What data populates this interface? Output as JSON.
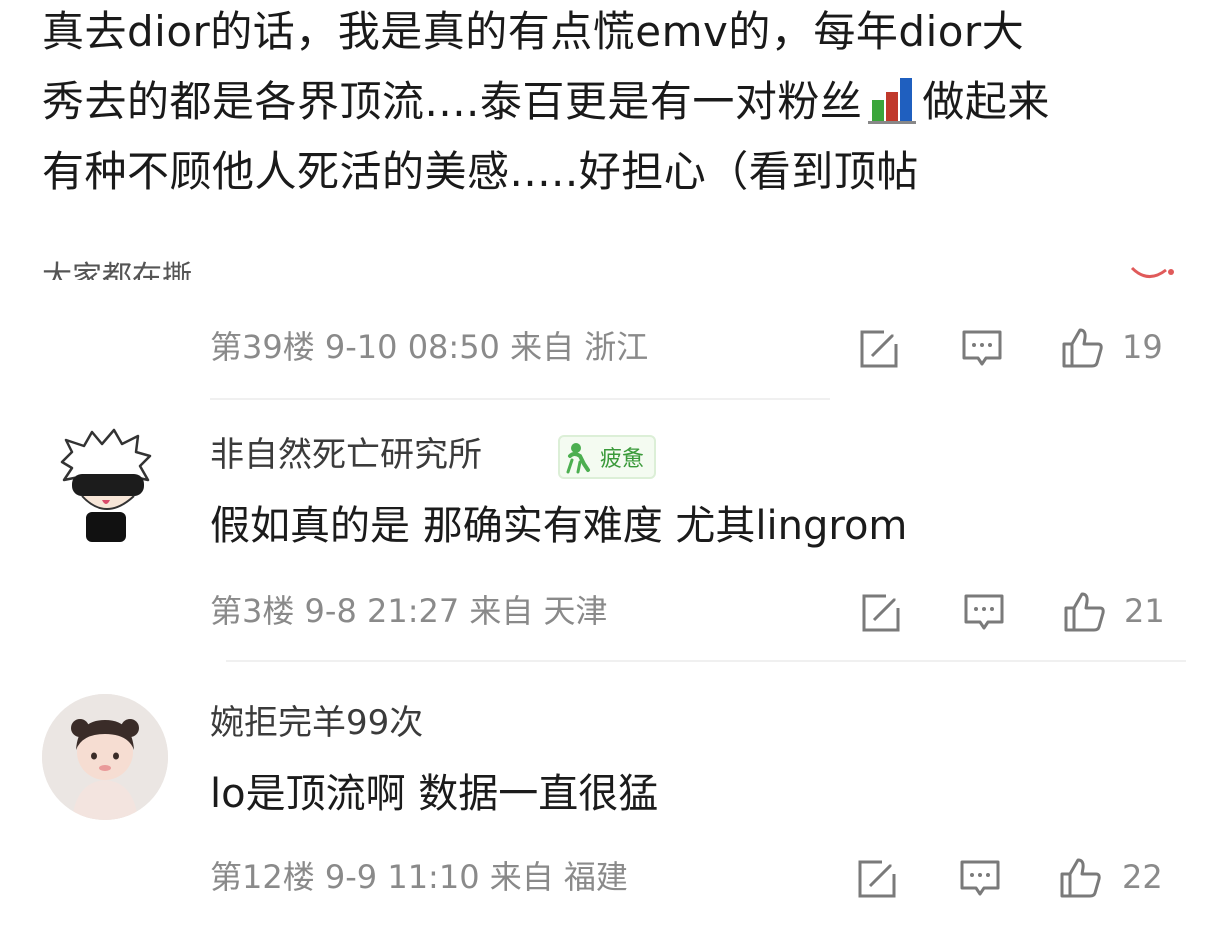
{
  "top_comment": {
    "line1": "真去dior的话，我是真的有点慌emv的，每年dior大",
    "line2_pre": "秀去的都是各界顶流....泰百更是有一对粉丝",
    "line2_post": "做起来",
    "line3": "有种不顾他人死活的美感.....好担心（看到顶帖",
    "emoji_icon": "bar-chart-emoji"
  },
  "reply_peek": {
    "text": "大家都在撕"
  },
  "post_39": {
    "meta": "第39楼  9-10 08:50  来自 浙江",
    "likes": "19"
  },
  "comment_1": {
    "username": "非自然死亡研究所",
    "badge_label": "疲惫",
    "text": "假如真的是 那确实有难度 尤其lingrom",
    "meta": "第3楼  9-8 21:27  来自 天津",
    "likes": "21"
  },
  "comment_2": {
    "username": "婉拒完羊99次",
    "text": "lo是顶流啊 数据一直很猛",
    "meta": "第12楼  9-9 11:10  来自 福建",
    "likes": "22"
  },
  "icons": {
    "share": "share-icon",
    "reply": "comment-icon",
    "like": "thumbs-up-icon"
  },
  "colors": {
    "text_primary": "#1b1b1b",
    "text_meta": "#8a8a8a",
    "badge_green": "#3a9a3a",
    "divider": "#f0f0f0"
  }
}
